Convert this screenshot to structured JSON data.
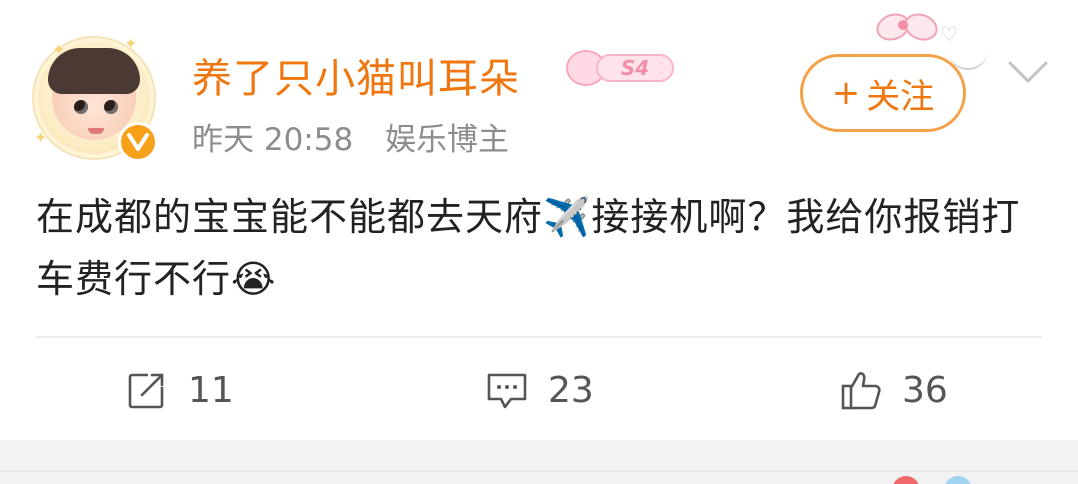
{
  "header": {
    "username": "养了只小猫叫耳朵",
    "level_badge": "S4",
    "timestamp": "昨天 20:58",
    "user_tag": "娱乐博主",
    "follow_label": "关注",
    "follow_plus": "+"
  },
  "post": {
    "text_part1": "在成都的宝宝能不能都去天府",
    "text_part2": "接接机啊？我给你报销打车费行不行",
    "emoji_airplane": "✈️",
    "emoji_crying": "😭"
  },
  "actions": {
    "repost_count": "11",
    "comment_count": "23",
    "like_count": "36"
  },
  "colors": {
    "accent": "#f0760f",
    "follow_border": "#f4a24a",
    "verify": "#f7a11a",
    "text": "#222222",
    "meta": "#8d8d8d"
  },
  "icons": {
    "verify": "verified-v-icon",
    "chevron": "chevron-down-icon",
    "repost": "repost-icon",
    "comment": "comment-icon",
    "like": "thumbs-up-icon"
  }
}
